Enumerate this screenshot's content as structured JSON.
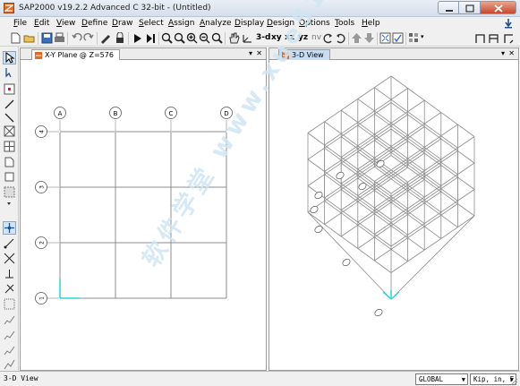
{
  "window": {
    "title": "SAP2000 v19.2.2 Advanced C 32-bit - (Untitled)"
  },
  "menu": [
    {
      "label": "File",
      "u": "F",
      "rest": "ile"
    },
    {
      "label": "Edit",
      "u": "E",
      "rest": "dit"
    },
    {
      "label": "View",
      "u": "V",
      "rest": "iew"
    },
    {
      "label": "Define",
      "u": "D",
      "rest": "efine"
    },
    {
      "label": "Draw",
      "u": "D",
      "rest": "raw"
    },
    {
      "label": "Select",
      "u": "S",
      "rest": "elect"
    },
    {
      "label": "Assign",
      "u": "A",
      "rest": "ssign"
    },
    {
      "label": "Analyze",
      "u": "A",
      "rest": "nalyze"
    },
    {
      "label": "Display",
      "u": "D",
      "rest": "isplay"
    },
    {
      "label": "Design",
      "u": "D",
      "rest": "esign"
    },
    {
      "label": "Options",
      "u": "O",
      "rest": "ptions"
    },
    {
      "label": "Tools",
      "u": "T",
      "rest": "ools"
    },
    {
      "label": "Help",
      "u": "H",
      "rest": "elp"
    }
  ],
  "toolbar": {
    "view_3d": "3-d",
    "view_xy": "xy",
    "view_xz": "xz",
    "view_yz": "yz",
    "view_nv": "nv"
  },
  "left_panel": {
    "tab_title": "X-Y Plane @ Z=576",
    "grid_x_labels": [
      "A",
      "B",
      "C",
      "D"
    ],
    "grid_y_labels": [
      "4",
      "3",
      "2",
      "1"
    ]
  },
  "right_panel": {
    "tab_title": "3-D View"
  },
  "watermark": "软件学堂 www.xue51.com",
  "status": {
    "view_label": "3-D View",
    "coord_system": "GLOBAL",
    "units": "Kip, in, F"
  },
  "colors": {
    "grid_line": "#8c8c8c",
    "axis_cyan": "#29d6d6",
    "tab_active": "#c8ddf2",
    "watermark": "#cfe6f4"
  }
}
